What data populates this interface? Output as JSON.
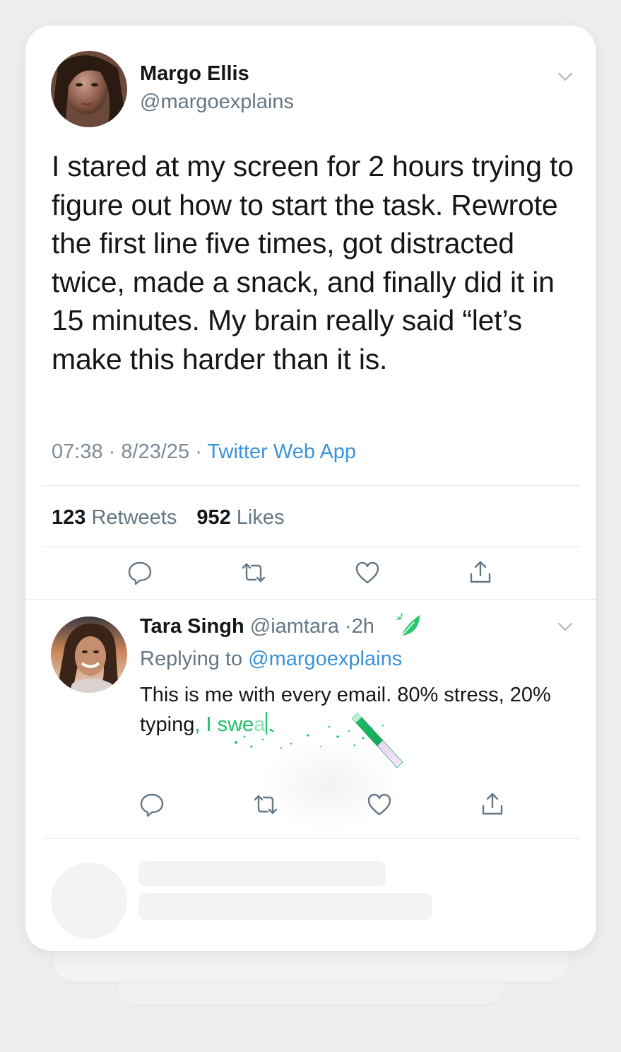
{
  "tweet": {
    "author_name": "Margo Ellis",
    "author_handle": "@margoexplains",
    "text": "I stared at my screen for 2 hours trying to figure out how to start the task. Rewrote the first line five times, got distracted twice, made a snack, and finally did it in 15 minutes. My brain really said “let’s make this harder than it is.",
    "time": "07:38",
    "date": "8/23/25",
    "separator": "·",
    "source": "Twitter Web App",
    "retweets_count": "123",
    "retweets_label": "Retweets",
    "likes_count": "952",
    "likes_label": "Likes"
  },
  "reply": {
    "author_name": "Tara Singh",
    "author_handle": "@iamtara",
    "age": "·2h",
    "replying_label": "Replying to",
    "replying_handle": "@margoexplains",
    "text_plain": "This is me with every email. 80% stress, 20% typing",
    "text_typed": ", I swe",
    "text_fading": "a",
    "text_after": "."
  },
  "icons": {
    "avatar_main": "avatar-photo",
    "avatar_reply": "avatar-photo",
    "menu": "chevron-down-icon",
    "reply": "reply-icon",
    "retweet": "retweet-icon",
    "like": "heart-icon",
    "share": "share-icon",
    "leaf": "leaf-icon",
    "wand": "magic-wand-icon"
  },
  "colors": {
    "text": "#14171a",
    "secondary": "#657786",
    "link": "#3b94d9",
    "accent_green": "#1fbf6a"
  }
}
